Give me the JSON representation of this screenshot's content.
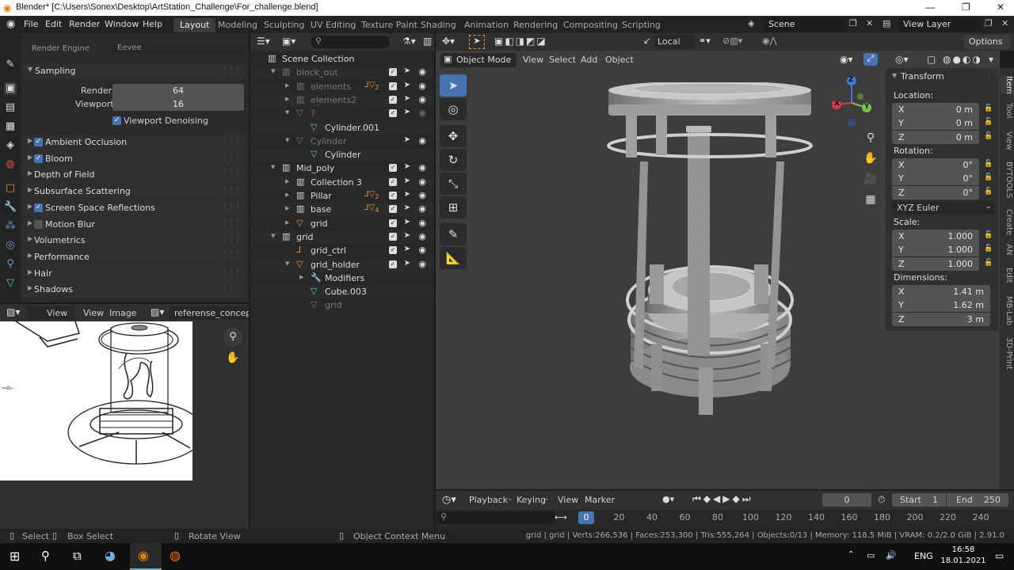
{
  "window": {
    "title": "Blender* [C:\\Users\\Sonex\\Desktop\\ArtStation_Challenge\\For_challenge.blend]",
    "minimize": "—",
    "maximize": "❐",
    "close": "✕"
  },
  "menu": [
    "File",
    "Edit",
    "Render",
    "Window",
    "Help"
  ],
  "workspaces": [
    "Layout",
    "Modeling",
    "Sculpting",
    "UV Editing",
    "Texture Paint",
    "Shading",
    "Animation",
    "Rendering",
    "Compositing",
    "Scripting"
  ],
  "active_workspace": "Layout",
  "scene": "Scene",
  "view_layer": "View Layer",
  "props": {
    "render_engine_label": "Render Engine",
    "render_engine_value": "Eevee",
    "sampling": {
      "title": "Sampling",
      "render_label": "Render",
      "render": "64",
      "viewport_label": "Viewport",
      "viewport": "16",
      "denoise": "Viewport Denoising"
    },
    "panels": [
      {
        "label": "Ambient Occlusion",
        "checkbox": true,
        "checked": true
      },
      {
        "label": "Bloom",
        "checkbox": true,
        "checked": true
      },
      {
        "label": "Depth of Field",
        "checkbox": false
      },
      {
        "label": "Subsurface Scattering",
        "checkbox": false
      },
      {
        "label": "Screen Space Reflections",
        "checkbox": true,
        "checked": true
      },
      {
        "label": "Motion Blur",
        "checkbox": true,
        "checked": false
      },
      {
        "label": "Volumetrics",
        "checkbox": false
      },
      {
        "label": "Performance",
        "checkbox": false
      },
      {
        "label": "Hair",
        "checkbox": false
      },
      {
        "label": "Shadows",
        "checkbox": false
      }
    ]
  },
  "image_editor": {
    "view": "View",
    "view2": "View",
    "image": "Image",
    "image_name": "referense_concept.j..."
  },
  "outliner": {
    "rows": [
      {
        "name": "Scene Collection",
        "indent": 0,
        "icon": "collection",
        "dim": false
      },
      {
        "name": "block_out",
        "indent": 1,
        "icon": "collection",
        "dim": true,
        "expand": "down"
      },
      {
        "name": "elements",
        "indent": 2,
        "icon": "collection",
        "dim": true,
        "expand": "right",
        "extra": "2"
      },
      {
        "name": "elements2",
        "indent": 2,
        "icon": "collection",
        "dim": true,
        "expand": "right"
      },
      {
        "name": "?",
        "indent": 2,
        "icon": "object",
        "dim": true,
        "expand": "down"
      },
      {
        "name": "Cylinder.001",
        "indent": 3,
        "icon": "mesh",
        "dim": false
      },
      {
        "name": "Cylinder",
        "indent": 2,
        "icon": "object",
        "dim": true,
        "expand": "down"
      },
      {
        "name": "Cylinder",
        "indent": 3,
        "icon": "mesh",
        "dim": false
      },
      {
        "name": "Mid_poly",
        "indent": 1,
        "icon": "collection",
        "dim": false,
        "expand": "down"
      },
      {
        "name": "Collection 3",
        "indent": 2,
        "icon": "collection",
        "dim": false,
        "expand": "right"
      },
      {
        "name": "Pillar",
        "indent": 2,
        "icon": "collection",
        "dim": false,
        "expand": "right",
        "extra": "2"
      },
      {
        "name": "base",
        "indent": 2,
        "icon": "collection",
        "dim": false,
        "expand": "right",
        "extra": "4"
      },
      {
        "name": "grid",
        "indent": 2,
        "icon": "object",
        "dim": false,
        "expand": "right"
      },
      {
        "name": "grid",
        "indent": 1,
        "icon": "collection",
        "dim": false,
        "expand": "down"
      },
      {
        "name": "grid_ctrl",
        "indent": 2,
        "icon": "empty",
        "dim": false
      },
      {
        "name": "grid_holder",
        "indent": 2,
        "icon": "object",
        "dim": false,
        "expand": "down"
      },
      {
        "name": "Modifiers",
        "indent": 3,
        "icon": "wrench",
        "dim": false,
        "expand": "right"
      },
      {
        "name": "Cube.003",
        "indent": 3,
        "icon": "mesh",
        "dim": false
      },
      {
        "name": "grid",
        "indent": 3,
        "icon": "object",
        "dim": true
      }
    ]
  },
  "viewport": {
    "mode": "Object Mode",
    "menus": [
      "View",
      "Select",
      "Add",
      "Object"
    ],
    "orientation": "Local",
    "options": "Options",
    "gizmo": {
      "x": "X",
      "y": "Y",
      "z": "Z"
    }
  },
  "npanel": {
    "title": "Transform",
    "location_label": "Location:",
    "location": [
      {
        "axis": "X",
        "value": "0 m"
      },
      {
        "axis": "Y",
        "value": "0 m"
      },
      {
        "axis": "Z",
        "value": "0 m"
      }
    ],
    "rotation_label": "Rotation:",
    "rotation": [
      {
        "axis": "X",
        "value": "0°"
      },
      {
        "axis": "Y",
        "value": "0°"
      },
      {
        "axis": "Z",
        "value": "0°"
      }
    ],
    "rotation_mode": "XYZ Euler",
    "scale_label": "Scale:",
    "scale": [
      {
        "axis": "X",
        "value": "1.000"
      },
      {
        "axis": "Y",
        "value": "1.000"
      },
      {
        "axis": "Z",
        "value": "1.000"
      }
    ],
    "dimensions_label": "Dimensions:",
    "dimensions": [
      {
        "axis": "X",
        "value": "1.41 m"
      },
      {
        "axis": "Y",
        "value": "1.62 m"
      },
      {
        "axis": "Z",
        "value": "3 m"
      }
    ],
    "tabs": [
      "Item",
      "Tool",
      "View",
      "BYTOOLS",
      "Create",
      "AN",
      "Edit",
      "MB-Lab",
      "3D-Print"
    ]
  },
  "timeline": {
    "menus": [
      "Playback",
      "Keying",
      "View",
      "Marker"
    ],
    "current": "0",
    "start_label": "Start",
    "start": "1",
    "end_label": "End",
    "end": "250",
    "ticks": [
      "0",
      "20",
      "40",
      "60",
      "80",
      "100",
      "120",
      "140",
      "160",
      "180",
      "200",
      "220",
      "240"
    ]
  },
  "status": {
    "select": "Select",
    "box_select": "Box Select",
    "rotate_view": "Rotate View",
    "context_menu": "Object Context Menu",
    "stats": "grid | grid | Verts:266,536 | Faces:253,300 | Tris:555,264 | Objects:0/13 | Memory: 118.5 MiB | VRAM: 0.2/2.0 GiB | 2.91.0"
  },
  "taskbar": {
    "lang": "ENG",
    "time": "16:58",
    "date": "18.01.2021"
  },
  "colors": {
    "accent": "#4772b3",
    "orange": "#e3923a",
    "mesh_green": "#5ec8a0",
    "bg": "#3d3d3d"
  }
}
